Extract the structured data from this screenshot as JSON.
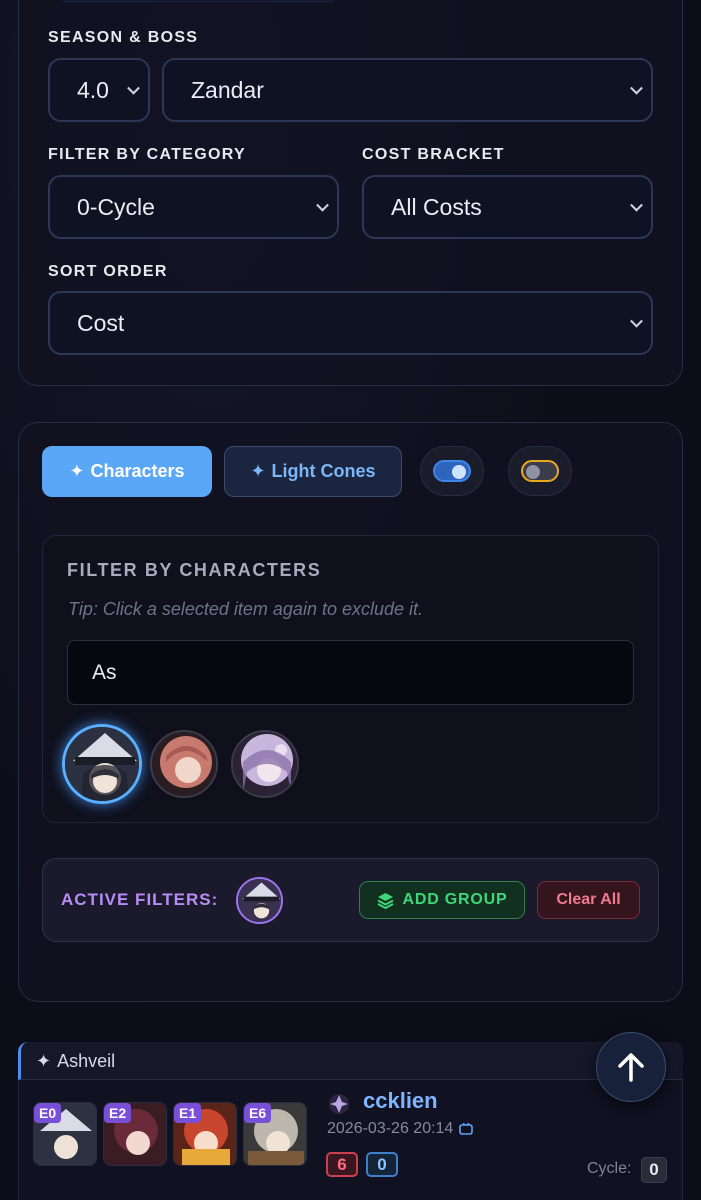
{
  "filters_panel": {
    "season_boss_label": "SEASON & BOSS",
    "season_value": "4.0",
    "boss_value": "Zandar",
    "category_label": "FILTER BY CATEGORY",
    "category_value": "0-Cycle",
    "cost_label": "COST BRACKET",
    "cost_value": "All Costs",
    "sort_label": "SORT ORDER",
    "sort_value": "Cost"
  },
  "tabs": {
    "characters": "Characters",
    "light_cones": "Light Cones",
    "sparkle": "✦"
  },
  "toggles": [
    {
      "name": "toggle-1",
      "on": true,
      "accent": "#3f86e8"
    },
    {
      "name": "toggle-2",
      "on": false,
      "accent": "#e8a920"
    }
  ],
  "character_filter": {
    "title": "FILTER BY CHARACTERS",
    "tip": "Tip: Click a selected item again to exclude it.",
    "search_value": "As",
    "results": [
      "dark-hat-character",
      "pink-hair-character",
      "lavender-hair-character"
    ]
  },
  "active_filters": {
    "label": "ACTIVE FILTERS:",
    "add_group": "ADD GROUP",
    "clear_all": "Clear All"
  },
  "result": {
    "title": "Ashveil",
    "team": [
      {
        "eidolon": "E0"
      },
      {
        "eidolon": "E2"
      },
      {
        "eidolon": "E1"
      },
      {
        "eidolon": "E6"
      }
    ],
    "player": "ccklien",
    "date": "2026-03-26 20:14",
    "stat_red": "6",
    "stat_blue": "0",
    "cycle_label": "Cycle:",
    "cycle_value": "0"
  },
  "colors": {
    "accent_blue": "#5aa6f7",
    "accent_purple": "#b98cf5",
    "add_green": "#3fd679",
    "clear_red": "#f07a8e"
  }
}
